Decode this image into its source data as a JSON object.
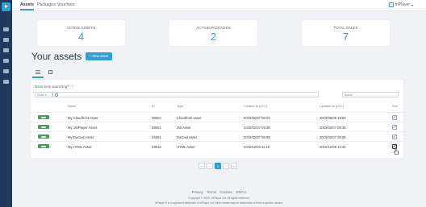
{
  "nav": {
    "tabs": [
      "Assets",
      "Packages",
      "Vouchers"
    ],
    "org": "InPlayer"
  },
  "stats": [
    {
      "label": "ACTIVE ASSETS",
      "value": "4"
    },
    {
      "label": "ACTIVE PACKAGES",
      "value": "2"
    },
    {
      "label": "TOTAL SALES",
      "value": "7"
    }
  ],
  "page": {
    "title": "Your assets",
    "new_asset_label": "+ New asset",
    "help_text": "Need help searching?",
    "show_label": "Show",
    "filter_label": "Active"
  },
  "table": {
    "headers": [
      "Name",
      "ID",
      "Type",
      "Created at (UTC)",
      "Updated at (UTC)",
      "Edit"
    ],
    "rows": [
      {
        "name": "My Cloudfront Asset",
        "id": "39003",
        "type": "Cloudfront asset",
        "created": "2019/02/07 08:01",
        "updated": "2019/06/09 18:53"
      },
      {
        "name": "My JWPlayer Asset",
        "id": "39002",
        "type": "JW Asset",
        "created": "2019/02/07 09:36",
        "updated": "2019/02/07 09:36"
      },
      {
        "name": "My DaCast Asset",
        "id": "34601",
        "type": "DaCast asset",
        "created": "2019/02/07 08:59",
        "updated": "2019/02/07 08:59"
      },
      {
        "name": "My HTML Asset",
        "id": "49516",
        "type": "HTML Asset",
        "created": "2019/12/03 11:16",
        "updated": "2019/12/06 14:22"
      }
    ]
  },
  "pagination": {
    "first": "«",
    "prev": "‹",
    "current": "1",
    "next": "›",
    "last": "»"
  },
  "footer": {
    "links": [
      "Privacy",
      "Terms",
      "Cookies",
      "DMCA"
    ],
    "copyright": "Copyright © 2020, InPlayer Ltd. All rights reserved.",
    "trademark": "InPlayer ® is a registered trademark of InPlayer Ltd. Other names may be trademarks of their respective owners."
  },
  "colors": {
    "accent": "#2f9fd8",
    "sidebar": "#1f3a5c",
    "thumb": "#3fa556"
  }
}
